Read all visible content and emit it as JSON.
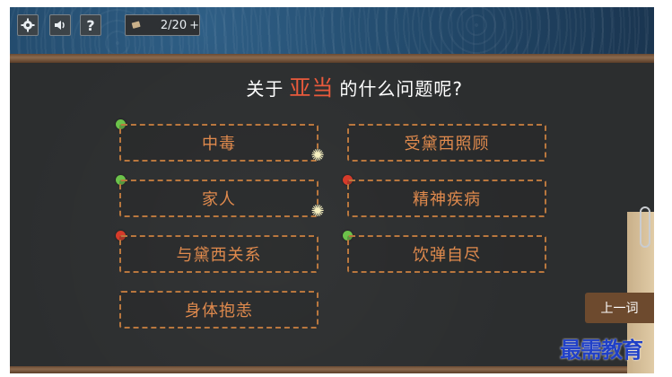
{
  "toolbar": {
    "settings_icon": "gear-icon",
    "sound_icon": "speaker-icon",
    "help_label": "?",
    "counter_text": "2/20",
    "counter_plus": "+"
  },
  "question": {
    "prefix": "关于",
    "name": "亚当",
    "suffix": "的什么问题呢?"
  },
  "options": [
    {
      "label": "中毒",
      "status": "green"
    },
    {
      "label": "受黛西照顾",
      "status": null
    },
    {
      "label": "家人",
      "status": "green"
    },
    {
      "label": "精神疾病",
      "status": "red"
    },
    {
      "label": "与黛西关系",
      "status": "red"
    },
    {
      "label": "饮弹自尽",
      "status": "green"
    },
    {
      "label": "身体抱恙",
      "status": null
    }
  ],
  "prev_button": {
    "label": "上一词"
  },
  "watermark": "最需教育",
  "colors": {
    "green": "#6cc24a",
    "red": "#d63b2a",
    "accent": "#e95a3c",
    "option_text": "#e08a4d"
  }
}
